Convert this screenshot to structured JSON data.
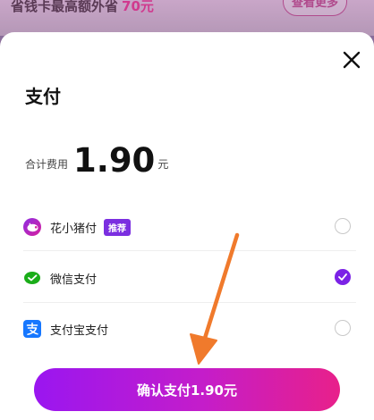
{
  "banner": {
    "text": "省钱卡最高额外省",
    "amount": "70元",
    "button_label": "查看更多"
  },
  "sheet": {
    "title": "支付",
    "total_label": "合计费用",
    "total_amount": "1.90",
    "total_unit": "元"
  },
  "methods": [
    {
      "label": "花小猪付",
      "badge": "推荐",
      "icon": "pig-icon",
      "selected": false
    },
    {
      "label": "微信支付",
      "icon": "wechat-pay-icon",
      "selected": true
    },
    {
      "label": "支付宝支付",
      "icon": "alipay-icon",
      "selected": false
    }
  ],
  "confirm": {
    "label": "确认支付1.90元"
  },
  "colors": {
    "accent": "#7b22e6",
    "button_start": "#9a16f0",
    "button_end": "#e8208a",
    "arrow": "#f07a2c",
    "wechat": "#1aad19",
    "alipay": "#1677ff"
  }
}
